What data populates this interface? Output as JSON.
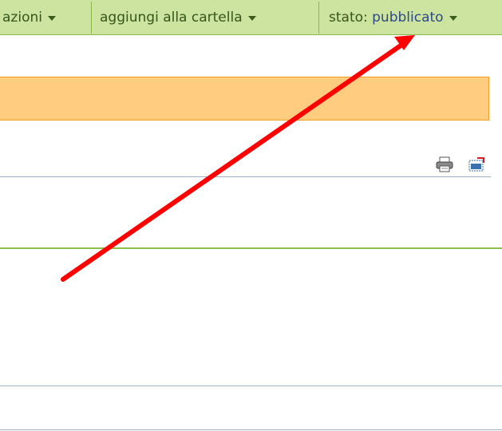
{
  "toolbar": {
    "actions_label": "azioni",
    "folder_label": "aggiungi alla cartella",
    "state_prefix": "stato: ",
    "state_value": "pubblicato"
  },
  "document_actions": {
    "print_icon": "printer-icon",
    "fullscreen_icon": "fullscreen-icon"
  },
  "colors": {
    "toolbar_bg": "#cde3a0",
    "state_value": "#2f4a82",
    "banner_bg": "#ffcc80",
    "banner_border": "#f0a020",
    "annotation_arrow": "#ff0000"
  }
}
